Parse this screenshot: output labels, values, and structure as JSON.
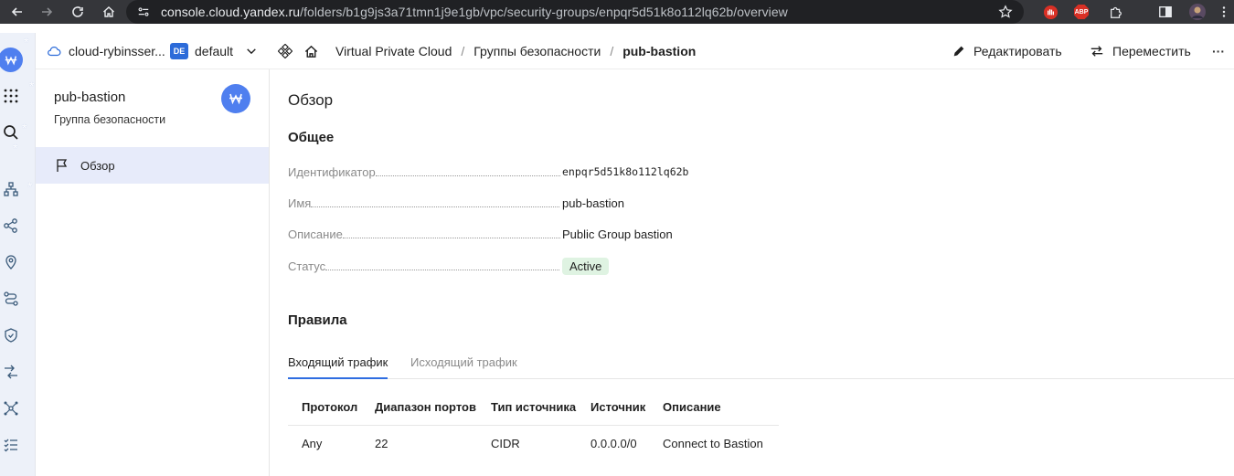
{
  "browser": {
    "url_host": "console.cloud.yandex.ru",
    "url_path": "/folders/b1g9js3a71tmn1j9e1gb/vpc/security-groups/enpqr5d51k8o112lq62b/overview",
    "ext_abp": "ABP"
  },
  "header": {
    "cloud_name": "cloud-rybinsser...",
    "folder_badge": "DE",
    "folder_name": "default",
    "breadcrumbs": [
      "Virtual Private Cloud",
      "Группы безопасности",
      "pub-bastion"
    ],
    "separator": "/",
    "edit_label": "Редактировать",
    "move_label": "Переместить",
    "more_label": "···"
  },
  "side": {
    "title": "pub-bastion",
    "subtitle": "Группа безопасности",
    "nav_overview": "Обзор"
  },
  "main": {
    "title": "Обзор",
    "general_title": "Общее",
    "props": [
      {
        "key": "Идентификатор",
        "value": "enpqr5d51k8o112lq62b"
      },
      {
        "key": "Имя",
        "value": "pub-bastion"
      },
      {
        "key": "Описание",
        "value": "Public Group bastion"
      },
      {
        "key": "Статус",
        "value": "Active"
      }
    ],
    "rules_title": "Правила",
    "tabs": [
      "Входящий трафик",
      "Исходящий трафик"
    ],
    "table": {
      "headers": [
        "Протокол",
        "Диапазон портов",
        "Тип источника",
        "Источник",
        "Описание"
      ],
      "rows": [
        [
          "Any",
          "22",
          "CIDR",
          "0.0.0.0/0",
          "Connect to Bastion"
        ]
      ]
    }
  },
  "colors": {
    "accent": "#4f7fef",
    "status_bg": "#dff3e2",
    "status_fg": "#2f9e44",
    "tab_underline": "#2f6de1"
  }
}
